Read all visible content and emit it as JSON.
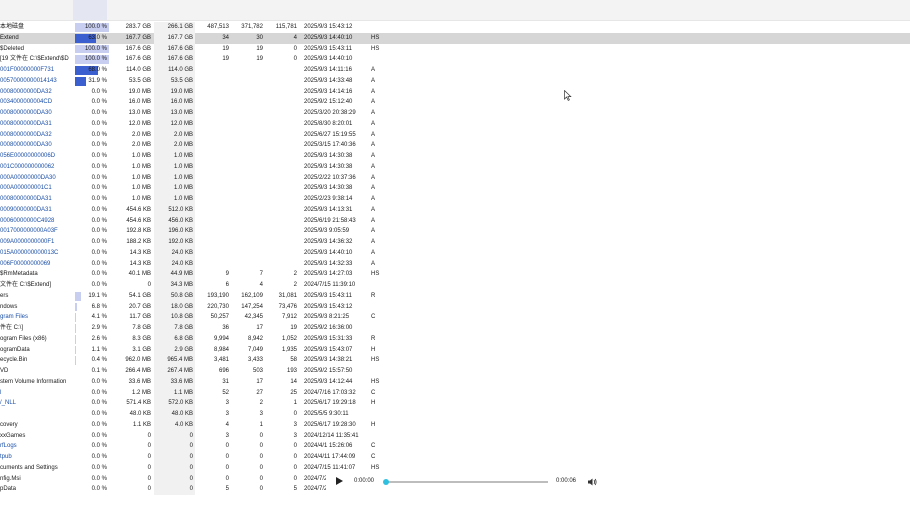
{
  "player": {
    "current_time": "0:00:00",
    "end_time": "0:00:06",
    "progress": 0.0
  },
  "rows": [
    {
      "name": "本地磁盘",
      "pct": "100.0 %",
      "pct_fill": 1.0,
      "size": "283.7 GB",
      "alloc": "266.1 GB",
      "items": "487,513",
      "files": "371,782",
      "folders": "115,781",
      "mod": "2025/9/3 15:43:12",
      "attr": "",
      "style": "normal"
    },
    {
      "name": "Extend",
      "pct": "63.0 %",
      "pct_fill": 0.63,
      "size": "167.7 GB",
      "alloc": "167.7 GB",
      "items": "34",
      "files": "30",
      "folders": "4",
      "mod": "2025/9/3 14:40:10",
      "attr": "HS",
      "style": "selected"
    },
    {
      "name": "$Deleted",
      "pct": "100.0 %",
      "pct_fill": 1.0,
      "size": "167.6 GB",
      "alloc": "167.6 GB",
      "items": "19",
      "files": "19",
      "folders": "0",
      "mod": "2025/9/3 15:43:11",
      "attr": "HS",
      "style": "normal"
    },
    {
      "name": "[19 文件在 C:\\$Extend\\$D",
      "pct": "100.0 %",
      "pct_fill": 1.0,
      "size": "167.6 GB",
      "alloc": "167.6 GB",
      "items": "19",
      "files": "19",
      "folders": "0",
      "mod": "2025/9/3 14:40:10",
      "attr": "",
      "style": "normal"
    },
    {
      "name": "001F00000000F731",
      "pct": "68.0 %",
      "pct_fill": 0.68,
      "size": "114.0 GB",
      "alloc": "114.0 GB",
      "items": "",
      "files": "",
      "folders": "",
      "mod": "2025/9/3 14:11:16",
      "attr": "A",
      "style": "blue"
    },
    {
      "name": "00570000000014143",
      "pct": "31.9 %",
      "pct_fill": 0.319,
      "size": "53.5 GB",
      "alloc": "53.5 GB",
      "items": "",
      "files": "",
      "folders": "",
      "mod": "2025/9/3 14:33:48",
      "attr": "A",
      "style": "blue"
    },
    {
      "name": "00080000000DA32",
      "pct": "0.0 %",
      "pct_fill": 0,
      "size": "19.0 MB",
      "alloc": "19.0 MB",
      "items": "",
      "files": "",
      "folders": "",
      "mod": "2025/9/3 14:14:16",
      "attr": "A",
      "style": "blue"
    },
    {
      "name": "0034000000004CD",
      "pct": "0.0 %",
      "pct_fill": 0,
      "size": "16.0 MB",
      "alloc": "16.0 MB",
      "items": "",
      "files": "",
      "folders": "",
      "mod": "2025/9/2 15:12:40",
      "attr": "A",
      "style": "blue"
    },
    {
      "name": "00080000000DA30",
      "pct": "0.0 %",
      "pct_fill": 0,
      "size": "13.0 MB",
      "alloc": "13.0 MB",
      "items": "",
      "files": "",
      "folders": "",
      "mod": "2025/3/20 20:38:29",
      "attr": "A",
      "style": "blue"
    },
    {
      "name": "00080000000DA31",
      "pct": "0.0 %",
      "pct_fill": 0,
      "size": "12.0 MB",
      "alloc": "12.0 MB",
      "items": "",
      "files": "",
      "folders": "",
      "mod": "2025/8/30 8:20:01",
      "attr": "A",
      "style": "blue"
    },
    {
      "name": "00080000000DA32",
      "pct": "0.0 %",
      "pct_fill": 0,
      "size": "2.0 MB",
      "alloc": "2.0 MB",
      "items": "",
      "files": "",
      "folders": "",
      "mod": "2025/6/27 15:19:55",
      "attr": "A",
      "style": "blue"
    },
    {
      "name": "00080000000DA30",
      "pct": "0.0 %",
      "pct_fill": 0,
      "size": "2.0 MB",
      "alloc": "2.0 MB",
      "items": "",
      "files": "",
      "folders": "",
      "mod": "2025/3/15 17:40:36",
      "attr": "A",
      "style": "blue"
    },
    {
      "name": "056E00000000006D",
      "pct": "0.0 %",
      "pct_fill": 0,
      "size": "1.0 MB",
      "alloc": "1.0 MB",
      "items": "",
      "files": "",
      "folders": "",
      "mod": "2025/9/3 14:30:38",
      "attr": "A",
      "style": "blue"
    },
    {
      "name": "001C000000000062",
      "pct": "0.0 %",
      "pct_fill": 0,
      "size": "1.0 MB",
      "alloc": "1.0 MB",
      "items": "",
      "files": "",
      "folders": "",
      "mod": "2025/9/3 14:30:38",
      "attr": "A",
      "style": "blue"
    },
    {
      "name": "000A00000000DA30",
      "pct": "0.0 %",
      "pct_fill": 0,
      "size": "1.0 MB",
      "alloc": "1.0 MB",
      "items": "",
      "files": "",
      "folders": "",
      "mod": "2025/2/22 10:37:36",
      "attr": "A",
      "style": "blue"
    },
    {
      "name": "000A000000001C1",
      "pct": "0.0 %",
      "pct_fill": 0,
      "size": "1.0 MB",
      "alloc": "1.0 MB",
      "items": "",
      "files": "",
      "folders": "",
      "mod": "2025/9/3 14:30:38",
      "attr": "A",
      "style": "blue"
    },
    {
      "name": "00080000000DA31",
      "pct": "0.0 %",
      "pct_fill": 0,
      "size": "1.0 MB",
      "alloc": "1.0 MB",
      "items": "",
      "files": "",
      "folders": "",
      "mod": "2025/2/23 9:38:14",
      "attr": "A",
      "style": "blue"
    },
    {
      "name": "00090000000DA31",
      "pct": "0.0 %",
      "pct_fill": 0,
      "size": "454.6 KB",
      "alloc": "512.0 KB",
      "items": "",
      "files": "",
      "folders": "",
      "mod": "2025/9/3 14:13:31",
      "attr": "A",
      "style": "blue"
    },
    {
      "name": "00060000000C4928",
      "pct": "0.0 %",
      "pct_fill": 0,
      "size": "454.6 KB",
      "alloc": "456.0 KB",
      "items": "",
      "files": "",
      "folders": "",
      "mod": "2025/6/19 21:58:43",
      "attr": "A",
      "style": "blue"
    },
    {
      "name": "0017000000000A03F",
      "pct": "0.0 %",
      "pct_fill": 0,
      "size": "192.8 KB",
      "alloc": "196.0 KB",
      "items": "",
      "files": "",
      "folders": "",
      "mod": "2025/9/3 9:05:59",
      "attr": "A",
      "style": "blue"
    },
    {
      "name": "009A0000000000F1",
      "pct": "0.0 %",
      "pct_fill": 0,
      "size": "188.2 KB",
      "alloc": "192.0 KB",
      "items": "",
      "files": "",
      "folders": "",
      "mod": "2025/9/3 14:36:32",
      "attr": "A",
      "style": "blue"
    },
    {
      "name": "015A000000000013C",
      "pct": "0.0 %",
      "pct_fill": 0,
      "size": "14.3 KB",
      "alloc": "24.0 KB",
      "items": "",
      "files": "",
      "folders": "",
      "mod": "2025/9/3 14:40:10",
      "attr": "A",
      "style": "blue"
    },
    {
      "name": "006F00000000069",
      "pct": "0.0 %",
      "pct_fill": 0,
      "size": "14.3 KB",
      "alloc": "24.0 KB",
      "items": "",
      "files": "",
      "folders": "",
      "mod": "2025/9/3 14:32:33",
      "attr": "A",
      "style": "blue"
    },
    {
      "name": "$RmMetadata",
      "pct": "0.0 %",
      "pct_fill": 0,
      "size": "40.1 MB",
      "alloc": "44.9 MB",
      "items": "9",
      "files": "7",
      "folders": "2",
      "mod": "2025/9/3 14:27:03",
      "attr": "HS",
      "style": "normal"
    },
    {
      "name": "文件在 C:\\$Extend]",
      "pct": "0.0 %",
      "pct_fill": 0,
      "size": "0",
      "alloc": "34.3 MB",
      "items": "6",
      "files": "4",
      "folders": "2",
      "mod": "2024/7/15 11:39:10",
      "attr": "",
      "style": "normal"
    },
    {
      "name": "ers",
      "pct": "19.1 %",
      "pct_fill": 0.191,
      "size": "54.1 GB",
      "alloc": "50.8 GB",
      "items": "193,190",
      "files": "162,109",
      "folders": "31,081",
      "mod": "2025/9/3 15:43:11",
      "attr": "R",
      "style": "normal"
    },
    {
      "name": "ndows",
      "pct": "6.8 %",
      "pct_fill": 0.068,
      "size": "20.7 GB",
      "alloc": "18.0 GB",
      "items": "220,730",
      "files": "147,254",
      "folders": "73,476",
      "mod": "2025/9/3 15:43:12",
      "attr": "",
      "style": "normal"
    },
    {
      "name": "gram Files",
      "pct": "4.1 %",
      "pct_fill": 0.041,
      "size": "11.7 GB",
      "alloc": "10.8 GB",
      "items": "50,257",
      "files": "42,345",
      "folders": "7,912",
      "mod": "2025/9/3 8:21:25",
      "attr": "C",
      "style": "blue"
    },
    {
      "name": "件在 C:\\]",
      "pct": "2.9 %",
      "pct_fill": 0.029,
      "size": "7.8 GB",
      "alloc": "7.8 GB",
      "items": "36",
      "files": "17",
      "folders": "19",
      "mod": "2025/9/2 16:36:00",
      "attr": "",
      "style": "normal"
    },
    {
      "name": "ogram Files (x86)",
      "pct": "2.6 %",
      "pct_fill": 0.026,
      "size": "8.3 GB",
      "alloc": "6.8 GB",
      "items": "9,994",
      "files": "8,942",
      "folders": "1,052",
      "mod": "2025/9/3 15:31:33",
      "attr": "R",
      "style": "normal"
    },
    {
      "name": "ogramData",
      "pct": "1.1 %",
      "pct_fill": 0.011,
      "size": "3.1 GB",
      "alloc": "2.9 GB",
      "items": "8,984",
      "files": "7,049",
      "folders": "1,935",
      "mod": "2025/9/3 15:43:07",
      "attr": "H",
      "style": "normal"
    },
    {
      "name": "ecycle.Bin",
      "pct": "0.4 %",
      "pct_fill": 0.004,
      "size": "962.0 MB",
      "alloc": "965.4 MB",
      "items": "3,481",
      "files": "3,433",
      "folders": "58",
      "mod": "2025/9/3 14:38:21",
      "attr": "HS",
      "style": "normal"
    },
    {
      "name": "VD",
      "pct": "0.1 %",
      "pct_fill": 0.001,
      "size": "266.4 MB",
      "alloc": "267.4 MB",
      "items": "696",
      "files": "503",
      "folders": "193",
      "mod": "2025/9/2 15:57:50",
      "attr": "",
      "style": "normal"
    },
    {
      "name": "stem Volume Information",
      "pct": "0.0 %",
      "pct_fill": 0,
      "size": "33.6 MB",
      "alloc": "33.6 MB",
      "items": "31",
      "files": "17",
      "folders": "14",
      "mod": "2025/9/3 14:12:44",
      "attr": "HS",
      "style": "normal"
    },
    {
      "name": "l",
      "pct": "0.0 %",
      "pct_fill": 0,
      "size": "1.2 MB",
      "alloc": "1.1 MB",
      "items": "52",
      "files": "27",
      "folders": "25",
      "mod": "2024/7/16 17:03:32",
      "attr": "C",
      "style": "blue"
    },
    {
      "name": "/_NLL",
      "pct": "0.0 %",
      "pct_fill": 0,
      "size": "571.4 KB",
      "alloc": "572.0 KB",
      "items": "3",
      "files": "2",
      "folders": "1",
      "mod": "2025/6/17 19:29:18",
      "attr": "H",
      "style": "blue"
    },
    {
      "name": "",
      "pct": "0.0 %",
      "pct_fill": 0,
      "size": "48.0 KB",
      "alloc": "48.0 KB",
      "items": "3",
      "files": "3",
      "folders": "0",
      "mod": "2025/5/5 9:30:11",
      "attr": "",
      "style": "normal"
    },
    {
      "name": "covery",
      "pct": "0.0 %",
      "pct_fill": 0,
      "size": "1.1 KB",
      "alloc": "4.0 KB",
      "items": "4",
      "files": "1",
      "folders": "3",
      "mod": "2025/6/17 19:28:30",
      "attr": "H",
      "style": "normal"
    },
    {
      "name": "xxGames",
      "pct": "0.0 %",
      "pct_fill": 0,
      "size": "0",
      "alloc": "0",
      "items": "3",
      "files": "0",
      "folders": "3",
      "mod": "2024/12/14 11:35:41",
      "attr": "",
      "style": "normal"
    },
    {
      "name": "rfLogs",
      "pct": "0.0 %",
      "pct_fill": 0,
      "size": "0",
      "alloc": "0",
      "items": "0",
      "files": "0",
      "folders": "0",
      "mod": "2024/4/1 15:26:06",
      "attr": "C",
      "style": "blue"
    },
    {
      "name": "tpub",
      "pct": "0.0 %",
      "pct_fill": 0,
      "size": "0",
      "alloc": "0",
      "items": "0",
      "files": "0",
      "folders": "0",
      "mod": "2024/4/11 17:44:09",
      "attr": "C",
      "style": "blue"
    },
    {
      "name": "cuments and Settings",
      "pct": "0.0 %",
      "pct_fill": 0,
      "size": "0",
      "alloc": "0",
      "items": "0",
      "files": "0",
      "folders": "0",
      "mod": "2024/7/15 11:41:07",
      "attr": "HS",
      "style": "normal"
    },
    {
      "name": "nfig.Msi",
      "pct": "0.0 %",
      "pct_fill": 0,
      "size": "0",
      "alloc": "0",
      "items": "0",
      "files": "0",
      "folders": "0",
      "mod": "2024/7/2",
      "attr": "",
      "style": "normal"
    },
    {
      "name": "pData",
      "pct": "0.0 %",
      "pct_fill": 0,
      "size": "0",
      "alloc": "0",
      "items": "5",
      "files": "0",
      "folders": "5",
      "mod": "2024/7/2",
      "attr": "",
      "style": "normal"
    }
  ]
}
